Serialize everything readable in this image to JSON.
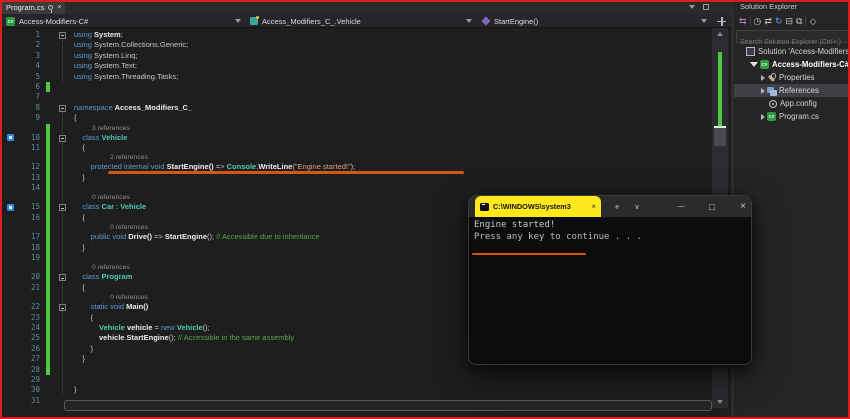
{
  "tab_bar": {
    "tab_title": "Program.cs"
  },
  "navbar": {
    "project": "Access-Modifiers-C#",
    "type": "Access_Modifiers_C_.Vehicle",
    "member": "StartEngine()"
  },
  "editor": {
    "lines": [
      {
        "t": "c",
        "n": 1,
        "f": 1,
        "s": [
          [
            "k",
            "using"
          ],
          [
            "p",
            " "
          ],
          [
            "w",
            "System"
          ],
          [
            "p",
            ";"
          ]
        ]
      },
      {
        "t": "c",
        "n": 2,
        "s": [
          [
            "k",
            "using"
          ],
          [
            "p",
            " System.Collections.Generic;"
          ]
        ]
      },
      {
        "t": "c",
        "n": 3,
        "s": [
          [
            "k",
            "using"
          ],
          [
            "p",
            " System.Linq;"
          ]
        ]
      },
      {
        "t": "c",
        "n": 4,
        "s": [
          [
            "k",
            "using"
          ],
          [
            "p",
            " System.Text;"
          ]
        ]
      },
      {
        "t": "c",
        "n": 5,
        "s": [
          [
            "k",
            "using"
          ],
          [
            "p",
            " System.Threading.Tasks;"
          ]
        ]
      },
      {
        "t": "c",
        "n": 6,
        "b": 1
      },
      {
        "t": "c",
        "n": 7
      },
      {
        "t": "c",
        "n": 8,
        "f": 1,
        "s": [
          [
            "k",
            "namespace"
          ],
          [
            "w",
            " Access_Modifiers_C_"
          ]
        ]
      },
      {
        "t": "c",
        "n": 9,
        "s": [
          [
            "p",
            "{"
          ]
        ]
      },
      {
        "t": "l",
        "x": 4,
        "b": 1,
        "txt": "3 references"
      },
      {
        "t": "c",
        "n": 10,
        "f": 1,
        "g": 1,
        "b": 1,
        "s": [
          [
            "p",
            "    "
          ],
          [
            "k",
            "class"
          ],
          [
            "y",
            " Vehicle"
          ]
        ]
      },
      {
        "t": "c",
        "n": 11,
        "b": 1,
        "s": [
          [
            "p",
            "    {"
          ]
        ]
      },
      {
        "t": "l",
        "x": 8,
        "b": 1,
        "txt": "2 references"
      },
      {
        "t": "c",
        "n": 12,
        "b": 1,
        "u": 1,
        "s": [
          [
            "p",
            "        "
          ],
          [
            "k",
            "protected"
          ],
          [
            "p",
            " "
          ],
          [
            "k",
            "internal"
          ],
          [
            "p",
            " "
          ],
          [
            "k",
            "void"
          ],
          [
            "w",
            " StartEngine()"
          ],
          [
            "p",
            " => "
          ],
          [
            "y",
            "Console"
          ],
          [
            "p",
            "."
          ],
          [
            "w",
            "WriteLine"
          ],
          [
            "p",
            "("
          ],
          [
            "s",
            "\"Engine started!\""
          ],
          [
            "p",
            ");"
          ]
        ]
      },
      {
        "t": "c",
        "n": 13,
        "b": 1,
        "s": [
          [
            "p",
            "    }"
          ]
        ]
      },
      {
        "t": "c",
        "n": 14,
        "b": 1
      },
      {
        "t": "l",
        "x": 4,
        "b": 1,
        "txt": "0 references"
      },
      {
        "t": "c",
        "n": 15,
        "f": 1,
        "g": 1,
        "b": 1,
        "s": [
          [
            "p",
            "    "
          ],
          [
            "k",
            "class"
          ],
          [
            "y",
            " Car"
          ],
          [
            "p",
            " : "
          ],
          [
            "y",
            "Vehicle"
          ]
        ]
      },
      {
        "t": "c",
        "n": 16,
        "b": 1,
        "s": [
          [
            "p",
            "    {"
          ]
        ]
      },
      {
        "t": "l",
        "x": 8,
        "b": 1,
        "txt": "0 references"
      },
      {
        "t": "c",
        "n": 17,
        "b": 1,
        "s": [
          [
            "p",
            "        "
          ],
          [
            "k",
            "public"
          ],
          [
            "p",
            " "
          ],
          [
            "k",
            "void"
          ],
          [
            "w",
            " Drive()"
          ],
          [
            "p",
            " => "
          ],
          [
            "w",
            "StartEngine"
          ],
          [
            "p",
            "(); "
          ],
          [
            "c",
            "// Accessible due to inheritance"
          ]
        ]
      },
      {
        "t": "c",
        "n": 18,
        "b": 1,
        "s": [
          [
            "p",
            "    }"
          ]
        ]
      },
      {
        "t": "c",
        "n": 19,
        "b": 1
      },
      {
        "t": "l",
        "x": 4,
        "b": 1,
        "txt": "0 references"
      },
      {
        "t": "c",
        "n": 20,
        "f": 1,
        "b": 1,
        "s": [
          [
            "p",
            "    "
          ],
          [
            "k",
            "class"
          ],
          [
            "y",
            " Program"
          ]
        ]
      },
      {
        "t": "c",
        "n": 21,
        "b": 1,
        "s": [
          [
            "p",
            "    {"
          ]
        ]
      },
      {
        "t": "l",
        "x": 8,
        "b": 1,
        "txt": "0 references"
      },
      {
        "t": "c",
        "n": 22,
        "f": 1,
        "b": 1,
        "s": [
          [
            "p",
            "        "
          ],
          [
            "k",
            "static"
          ],
          [
            "p",
            " "
          ],
          [
            "k",
            "void"
          ],
          [
            "w",
            " Main()"
          ]
        ]
      },
      {
        "t": "c",
        "n": 23,
        "b": 1,
        "s": [
          [
            "p",
            "        {"
          ]
        ]
      },
      {
        "t": "c",
        "n": 24,
        "b": 1,
        "s": [
          [
            "p",
            "            "
          ],
          [
            "y",
            "Vehicle"
          ],
          [
            "w",
            " vehicle"
          ],
          [
            "p",
            " = "
          ],
          [
            "k",
            "new"
          ],
          [
            "p",
            " "
          ],
          [
            "y",
            "Vehicle"
          ],
          [
            "p",
            "();"
          ]
        ]
      },
      {
        "t": "c",
        "n": 25,
        "b": 1,
        "s": [
          [
            "p",
            "            "
          ],
          [
            "w",
            "vehicle"
          ],
          [
            "p",
            "."
          ],
          [
            "w",
            "StartEngine"
          ],
          [
            "p",
            "(); "
          ],
          [
            "c",
            "// Accessible in the same assembly"
          ]
        ]
      },
      {
        "t": "c",
        "n": 26,
        "b": 1,
        "s": [
          [
            "p",
            "        }"
          ]
        ]
      },
      {
        "t": "c",
        "n": 27,
        "b": 1,
        "s": [
          [
            "p",
            "    }"
          ]
        ]
      },
      {
        "t": "c",
        "n": 28,
        "b": 1
      },
      {
        "t": "c",
        "n": 29
      },
      {
        "t": "c",
        "n": 30,
        "s": [
          [
            "p",
            "}"
          ]
        ]
      },
      {
        "t": "c",
        "n": 31
      }
    ]
  },
  "console": {
    "tab_title": "C:\\WINDOWS\\system3",
    "controls": {
      "tab_close": "×",
      "new_tab": "+",
      "dropdown": "∨",
      "minimize": "—",
      "maximize": "□",
      "close": "×"
    },
    "lines": [
      "Engine started!",
      "Press any key to continue . . ."
    ]
  },
  "solution_explorer": {
    "title": "Solution Explorer",
    "search_placeholder": "Search Solution Explorer (Ctrl+;)",
    "toolbar": [
      {
        "name": "switch-views-icon",
        "glyph": "⇆",
        "color": "#b180d7"
      },
      {
        "name": "separator",
        "glyph": "",
        "color": ""
      },
      {
        "name": "pending-changes-filter-icon",
        "glyph": "◷",
        "color": "#c5c5c5"
      },
      {
        "name": "sync-with-active-document-icon",
        "glyph": "⇄",
        "color": "#c5c5c5"
      },
      {
        "name": "refresh-icon",
        "glyph": "↻",
        "color": "#58a6ff"
      },
      {
        "name": "collapse-all-icon",
        "glyph": "⊟",
        "color": "#c5c5c5"
      },
      {
        "name": "show-all-files-icon",
        "glyph": "⧉",
        "color": "#c5c5c5"
      },
      {
        "name": "separator",
        "glyph": "",
        "color": ""
      },
      {
        "name": "preview-icon",
        "glyph": "◇",
        "color": "#c5c5c5"
      }
    ],
    "tree": [
      {
        "label": "Solution 'Access-Modifiers-",
        "icon": "sol",
        "indent": 0
      },
      {
        "label": "Access-Modifiers-C#",
        "icon": "cs",
        "indent": 1,
        "bold": true,
        "exp": "e"
      },
      {
        "label": "Properties",
        "icon": "wrench",
        "indent": 2,
        "exp": "c"
      },
      {
        "label": "References",
        "icon": "refs",
        "indent": 2,
        "exp": "c",
        "selected": true
      },
      {
        "label": "App.config",
        "icon": "cfg",
        "indent": 2
      },
      {
        "label": "Program.cs",
        "icon": "cs",
        "indent": 2,
        "exp": "c"
      }
    ]
  },
  "annotation_color": "#d4570b",
  "highlight_color": "#ffe81c"
}
